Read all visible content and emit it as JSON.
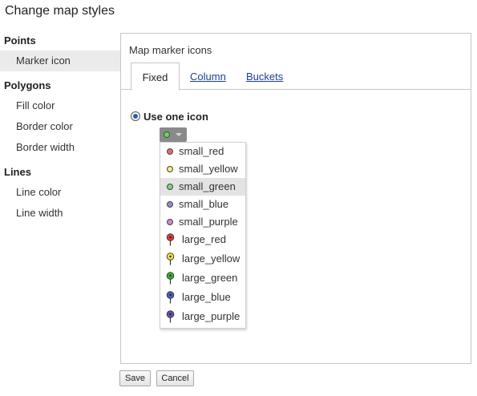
{
  "dialog": {
    "title": "Change map styles"
  },
  "sidebar": {
    "sections": [
      {
        "heading": "Points",
        "items": [
          "Marker icon"
        ]
      },
      {
        "heading": "Polygons",
        "items": [
          "Fill color",
          "Border color",
          "Border width"
        ]
      },
      {
        "heading": "Lines",
        "items": [
          "Line color",
          "Line width"
        ]
      }
    ],
    "selected": "Marker icon"
  },
  "panel": {
    "label": "Map marker icons",
    "tabs": [
      "Fixed",
      "Column",
      "Buckets"
    ],
    "active_tab": "Fixed",
    "option_label": "Use one icon",
    "option_selected": true,
    "picker_icon": "small-green-dot-icon",
    "dropdown": {
      "highlighted": "small_green",
      "options": [
        {
          "label": "small_red",
          "kind": "small",
          "color": "#e56b6b"
        },
        {
          "label": "small_yellow",
          "kind": "small",
          "color": "#f5ef7a"
        },
        {
          "label": "small_green",
          "kind": "small",
          "color": "#7bd67b"
        },
        {
          "label": "small_blue",
          "kind": "small",
          "color": "#8c8fd4"
        },
        {
          "label": "small_purple",
          "kind": "small",
          "color": "#c98bc9"
        },
        {
          "label": "large_red",
          "kind": "large",
          "color": "#e03c3c"
        },
        {
          "label": "large_yellow",
          "kind": "large",
          "color": "#f2e233"
        },
        {
          "label": "large_green",
          "kind": "large",
          "color": "#35b335"
        },
        {
          "label": "large_blue",
          "kind": "large",
          "color": "#4a5fc1"
        },
        {
          "label": "large_purple",
          "kind": "large",
          "color": "#6a4ab3"
        }
      ]
    }
  },
  "buttons": {
    "save": "Save",
    "cancel": "Cancel"
  },
  "colors": {
    "link": "#1a3e9c",
    "selected_item_bg": "#ebebeb",
    "radio_fill": "#2a5db0"
  }
}
